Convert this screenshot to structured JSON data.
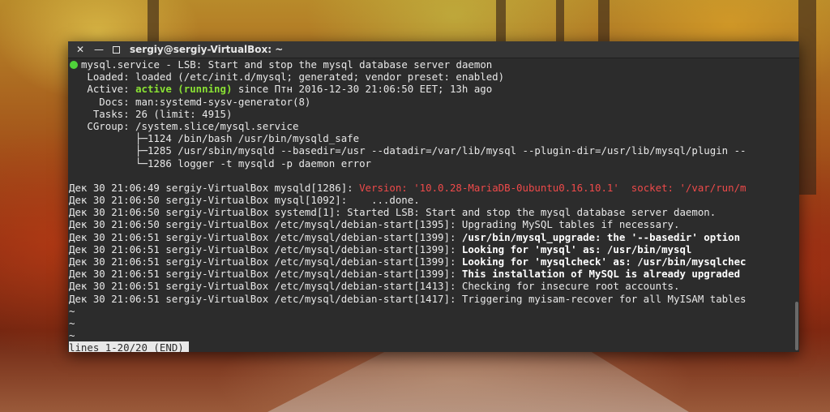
{
  "window": {
    "title": "sergiy@sergiy-VirtualBox: ~",
    "close_icon": "close-icon",
    "minimize_icon": "minimize-icon",
    "maximize_icon": "maximize-icon"
  },
  "terminal": {
    "header": {
      "service": "mysql.service - LSB: Start and stop the mysql database server daemon",
      "loaded": "   Loaded: loaded (/etc/init.d/mysql; generated; vendor preset: enabled)",
      "active_label": "   Active: ",
      "active_state": "active (running)",
      "active_rest": " since Птн 2016-12-30 21:06:50 EET; 13h ago",
      "docs": "     Docs: man:systemd-sysv-generator(8)",
      "tasks": "    Tasks: 26 (limit: 4915)",
      "cgroup": "   CGroup: /system.slice/mysql.service",
      "cgroup_items": [
        "           ├─1124 /bin/bash /usr/bin/mysqld_safe",
        "           ├─1285 /usr/sbin/mysqld --basedir=/usr --datadir=/var/lib/mysql --plugin-dir=/usr/lib/mysql/plugin --",
        "           └─1286 logger -t mysqld -p daemon error"
      ]
    },
    "log": [
      {
        "prefix": "Дек 30 21:06:49 sergiy-VirtualBox mysqld[1286]: ",
        "msg": "Version: '10.0.28-MariaDB-0ubuntu0.16.10.1'  socket: '/var/run/m"
      },
      {
        "prefix": "Дек 30 21:06:50 sergiy-VirtualBox mysql[1092]: ",
        "msg": "   ...done."
      },
      {
        "prefix": "Дек 30 21:06:50 sergiy-VirtualBox systemd[1]: ",
        "msg": "Started LSB: Start and stop the mysql database server daemon."
      },
      {
        "prefix": "Дек 30 21:06:50 sergiy-VirtualBox /etc/mysql/debian-start[1395]: ",
        "msg": "Upgrading MySQL tables if necessary."
      },
      {
        "prefix": "Дек 30 21:06:51 sergiy-VirtualBox /etc/mysql/debian-start[1399]: ",
        "msg": "/usr/bin/mysql_upgrade: the '--basedir' option"
      },
      {
        "prefix": "Дек 30 21:06:51 sergiy-VirtualBox /etc/mysql/debian-start[1399]: ",
        "msg": "Looking for 'mysql' as: /usr/bin/mysql"
      },
      {
        "prefix": "Дек 30 21:06:51 sergiy-VirtualBox /etc/mysql/debian-start[1399]: ",
        "msg": "Looking for 'mysqlcheck' as: /usr/bin/mysqlchec"
      },
      {
        "prefix": "Дек 30 21:06:51 sergiy-VirtualBox /etc/mysql/debian-start[1399]: ",
        "msg": "This installation of MySQL is already upgraded"
      },
      {
        "prefix": "Дек 30 21:06:51 sergiy-VirtualBox /etc/mysql/debian-start[1413]: ",
        "msg": "Checking for insecure root accounts."
      },
      {
        "prefix": "Дек 30 21:06:51 sergiy-VirtualBox /etc/mysql/debian-start[1417]: ",
        "msg": "Triggering myisam-recover for all MyISAM tables"
      }
    ],
    "tilde": "~",
    "status_line": "lines 1-20/20 (END)"
  },
  "colors": {
    "terminal_bg": "#2c2c2c",
    "active_green": "#8ae234",
    "error_red": "#ef4a4a",
    "status_dot": "#4fd23a"
  }
}
